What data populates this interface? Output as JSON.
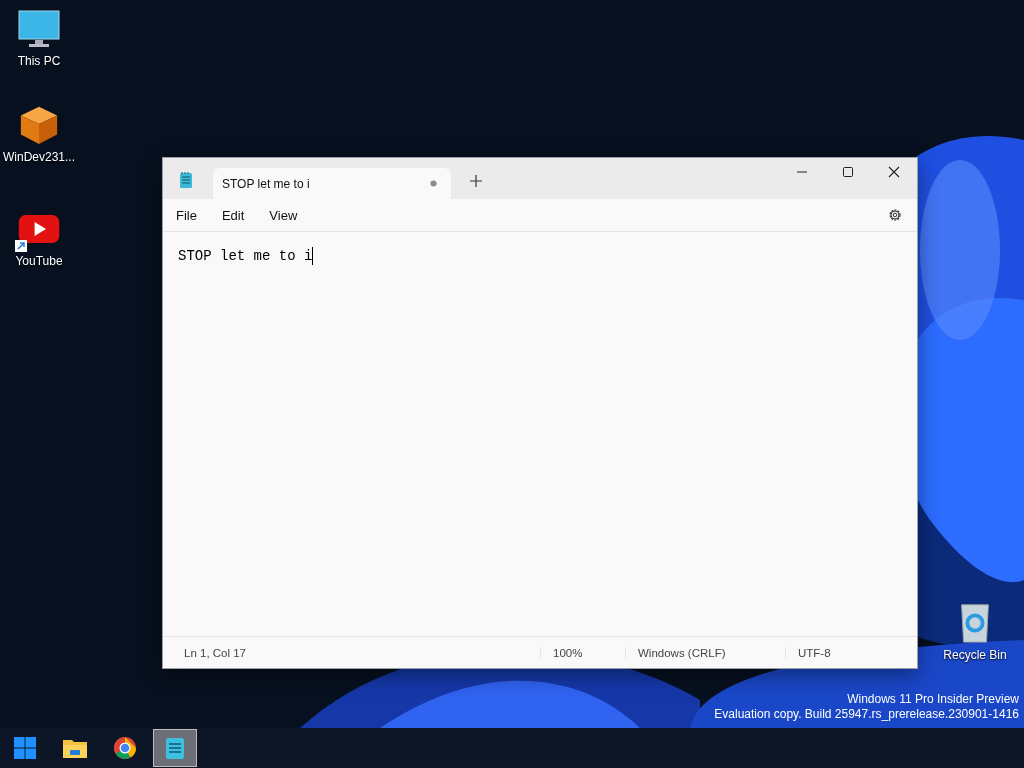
{
  "desktop_icons": [
    {
      "label": "This PC",
      "kind": "monitor",
      "shortcut": false
    },
    {
      "label": "WinDev231...",
      "kind": "package",
      "shortcut": false
    },
    {
      "label": "YouTube",
      "kind": "youtube",
      "shortcut": true
    }
  ],
  "recycle_bin": {
    "label": "Recycle Bin"
  },
  "window": {
    "tabs": [
      {
        "title": "STOP let me to i",
        "modified": true,
        "selected": true
      }
    ],
    "menu": [
      "File",
      "Edit",
      "View"
    ],
    "editor": {
      "text": "STOP let me to i"
    },
    "status_bar": [
      "Ln 1, Col 17",
      "100%",
      "Windows (CRLF)",
      "UTF-8"
    ]
  },
  "watermark_lines": [
    "Windows 11 Pro Insider Preview",
    "Evaluation copy. Build 25947.rs_prerelease.230901-1416"
  ],
  "taskbar": [
    {
      "kind": "start",
      "selected": false
    },
    {
      "kind": "folder",
      "selected": false
    },
    {
      "kind": "chrome",
      "selected": false
    },
    {
      "kind": "notepad",
      "selected": true
    }
  ]
}
